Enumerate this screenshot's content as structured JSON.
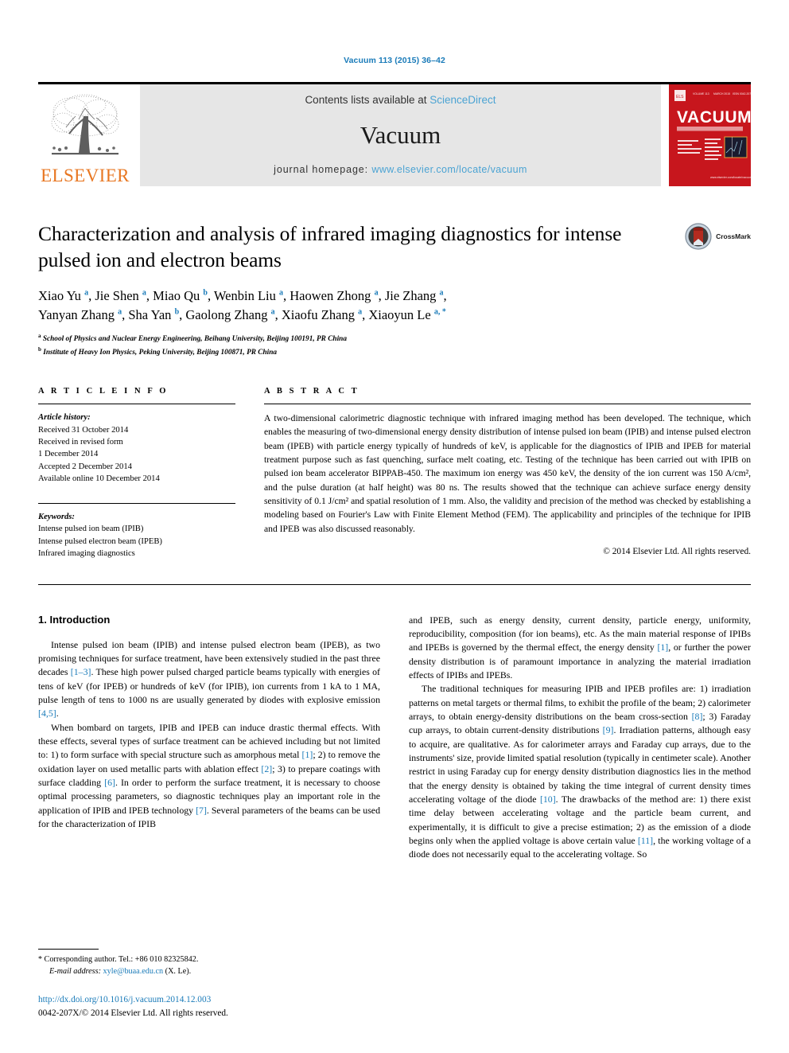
{
  "running_head": "Vacuum 113 (2015) 36–42",
  "masthead": {
    "publisher": "ELSEVIER",
    "contents_prefix": "Contents lists available at ",
    "contents_link": "ScienceDirect",
    "journal_name": "Vacuum",
    "homepage_prefix": "journal homepage: ",
    "homepage_url": "www.elsevier.com/locate/vacuum",
    "cover_title": "VACUUM",
    "cover_subtitle": "surface engineering, surface instrumentation & vacuum technology",
    "link_color": "#4ba3d3"
  },
  "article": {
    "title": "Characterization and analysis of infrared imaging diagnostics for intense pulsed ion and electron beams",
    "crossmark_label": "CrossMark",
    "authors_line1": "Xiao Yu <sup>a</sup>, Jie Shen <sup>a</sup>, Miao Qu <sup>b</sup>, Wenbin Liu <sup>a</sup>, Haowen Zhong <sup>a</sup>, Jie Zhang <sup>a</sup>,",
    "authors_line2": "Yanyan Zhang <sup>a</sup>, Sha Yan <sup>b</sup>, Gaolong Zhang <sup>a</sup>, Xiaofu Zhang <sup>a</sup>, Xiaoyun Le <sup>a, *</sup>",
    "affiliation_a": "<sup>a</sup> School of Physics and Nuclear Energy Engineering, Beihang University, Beijing 100191, PR China",
    "affiliation_b": "<sup>b</sup> Institute of Heavy Ion Physics, Peking University, Beijing 100871, PR China"
  },
  "article_info": {
    "heading": "A R T I C L E  I N F O",
    "history_label": "Article history:",
    "history": [
      "Received 31 October 2014",
      "Received in revised form",
      "1 December 2014",
      "Accepted 2 December 2014",
      "Available online 10 December 2014"
    ],
    "keywords_label": "Keywords:",
    "keywords": [
      "Intense pulsed ion beam (IPIB)",
      "Intense pulsed electron beam (IPEB)",
      "Infrared imaging diagnostics"
    ]
  },
  "abstract": {
    "heading": "A B S T R A C T",
    "text": "A two-dimensional calorimetric diagnostic technique with infrared imaging method has been developed. The technique, which enables the measuring of two-dimensional energy density distribution of intense pulsed ion beam (IPIB) and intense pulsed electron beam (IPEB) with particle energy typically of hundreds of keV, is applicable for the diagnostics of IPIB and IPEB for material treatment purpose such as fast quenching, surface melt coating, etc. Testing of the technique has been carried out with IPIB on pulsed ion beam accelerator BIPPAB-450. The maximum ion energy was 450 keV, the density of the ion current was 150 A/cm², and the pulse duration (at half height) was 80 ns. The results showed that the technique can achieve surface energy density sensitivity of 0.1 J/cm² and spatial resolution of 1 mm. Also, the validity and precision of the method was checked by establishing a modeling based on Fourier's Law with Finite Element Method (FEM). The applicability and principles of the technique for IPIB and IPEB was also discussed reasonably.",
    "copyright": "© 2014 Elsevier Ltd. All rights reserved."
  },
  "body": {
    "section_heading": "1. Introduction",
    "left_paragraphs": [
      "Intense pulsed ion beam (IPIB) and intense pulsed electron beam (IPEB), as two promising techniques for surface treatment, have been extensively studied in the past three decades <span class=\"ref\">[1–3]</span>. These high power pulsed charged particle beams typically with energies of tens of keV (for IPEB) or hundreds of keV (for IPIB), ion currents from 1 kA to 1 MA, pulse length of tens to 1000 ns are usually generated by diodes with explosive emission <span class=\"ref\">[4,5]</span>.",
      "When bombard on targets, IPIB and IPEB can induce drastic thermal effects. With these effects, several types of surface treatment can be achieved including but not limited to: 1) to form surface with special structure such as amorphous metal <span class=\"ref\">[1]</span>; 2) to remove the oxidation layer on used metallic parts with ablation effect <span class=\"ref\">[2]</span>; 3) to prepare coatings with surface cladding <span class=\"ref\">[6]</span>. In order to perform the surface treatment, it is necessary to choose optimal processing parameters, so diagnostic techniques play an important role in the application of IPIB and IPEB technology <span class=\"ref\">[7]</span>. Several parameters of the beams can be used for the characterization of IPIB"
    ],
    "right_paragraphs": [
      "and IPEB, such as energy density, current density, particle energy, uniformity, reproducibility, composition (for ion beams), etc. As the main material response of IPIBs and IPEBs is governed by the thermal effect, the energy density <span class=\"ref\">[1]</span>, or further the power density distribution is of paramount importance in analyzing the material irradiation effects of IPIBs and IPEBs.",
      "The traditional techniques for measuring IPIB and IPEB profiles are: 1) irradiation patterns on metal targets or thermal films, to exhibit the profile of the beam; 2) calorimeter arrays, to obtain energy-density distributions on the beam cross-section <span class=\"ref\">[8]</span>; 3) Faraday cup arrays, to obtain current-density distributions <span class=\"ref\">[9]</span>. Irradiation patterns, although easy to acquire, are qualitative. As for calorimeter arrays and Faraday cup arrays, due to the instruments' size, provide limited spatial resolution (typically in centimeter scale). Another restrict in using Faraday cup for energy density distribution diagnostics lies in the method that the energy density is obtained by taking the time integral of current density times accelerating voltage of the diode <span class=\"ref\">[10]</span>. The drawbacks of the method are: 1) there exist time delay between accelerating voltage and the particle beam current, and experimentally, it is difficult to give a precise estimation; 2) as the emission of a diode begins only when the applied voltage is above certain value <span class=\"ref\">[11]</span>, the working voltage of a diode does not necessarily equal to the accelerating voltage. So"
    ]
  },
  "footer": {
    "corresponding_star": "*",
    "corresponding_text": "Corresponding author. Tel.: +86 010 82325842.",
    "email_label": "E-mail address:",
    "email": "xyle@buaa.edu.cn",
    "email_suffix": "(X. Le).",
    "doi": "http://dx.doi.org/10.1016/j.vacuum.2014.12.003",
    "issn_line": "0042-207X/© 2014 Elsevier Ltd. All rights reserved."
  }
}
